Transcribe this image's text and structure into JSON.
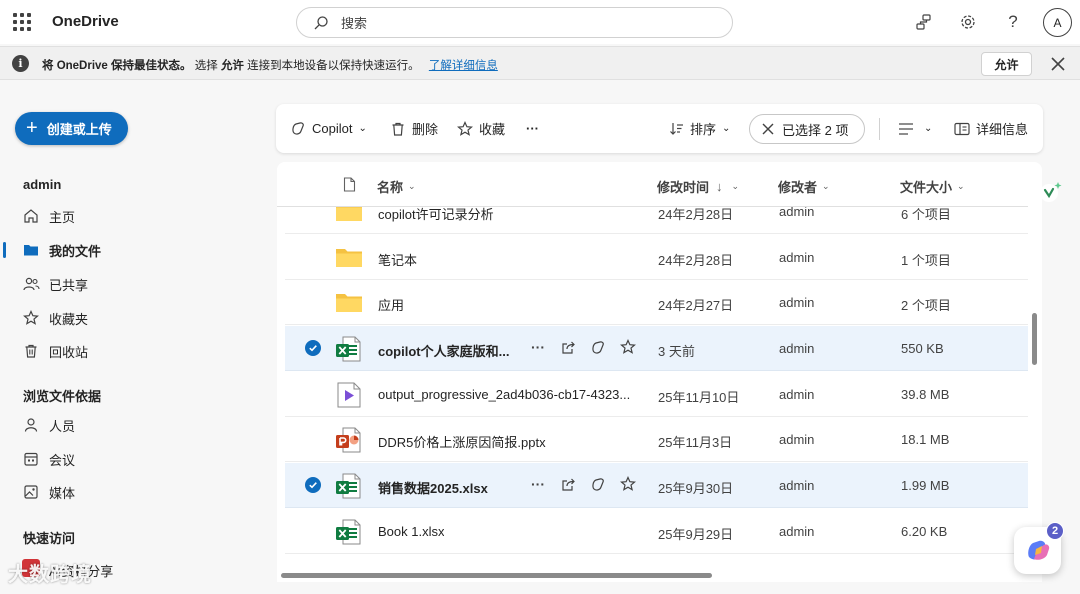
{
  "app": {
    "name": "OneDrive"
  },
  "search": {
    "placeholder": "搜索"
  },
  "top_icons": [
    "network-icon",
    "settings-gear-icon",
    "help-question-icon"
  ],
  "user": {
    "avatar_initial": "A"
  },
  "banner": {
    "prefix": "将 OneDrive 保持最佳状态。",
    "text1": "选择",
    "allow_bold": "允许",
    "text2": "连接到本地设备以保持快速运行。",
    "link": "了解详细信息",
    "allow_button": "允许"
  },
  "sidebar": {
    "create_label": "创建或上传",
    "account": "admin",
    "items": [
      {
        "label": "主页",
        "icon": "home-icon"
      },
      {
        "label": "我的文件",
        "icon": "folder-icon",
        "active": true
      },
      {
        "label": "已共享",
        "icon": "people-icon"
      },
      {
        "label": "收藏夹",
        "icon": "star-icon"
      },
      {
        "label": "回收站",
        "icon": "trash-icon"
      }
    ],
    "browse_heading": "浏览文件依据",
    "browse_items": [
      {
        "label": "人员",
        "icon": "person-icon"
      },
      {
        "label": "会议",
        "icon": "calendar-icon"
      },
      {
        "label": "媒体",
        "icon": "image-icon"
      }
    ],
    "quick_heading": "快速访问",
    "quick_partial": "AI资料分享"
  },
  "commandbar": {
    "copilot": "Copilot",
    "delete": "删除",
    "favorite": "收藏",
    "more": "···",
    "sort": "排序",
    "selected": "已选择 2 项",
    "details": "详细信息"
  },
  "columns": {
    "name": "名称",
    "modified": "修改时间",
    "modified_sort": "↓",
    "modified_by": "修改者",
    "size": "文件大小"
  },
  "files": [
    {
      "name": "copilot许可记录分析",
      "type": "folder",
      "modified": "24年2月28日",
      "by": "admin",
      "size": "6 个项目",
      "selected": false
    },
    {
      "name": "笔记本",
      "type": "folder",
      "modified": "24年2月28日",
      "by": "admin",
      "size": "1 个项目",
      "selected": false
    },
    {
      "name": "应用",
      "type": "folder",
      "modified": "24年2月27日",
      "by": "admin",
      "size": "2 个项目",
      "selected": false
    },
    {
      "name": "copilot个人家庭版和...",
      "type": "excel",
      "modified": "3 天前",
      "by": "admin",
      "size": "550 KB",
      "selected": true
    },
    {
      "name": "output_progressive_2ad4b036-cb17-4323...",
      "type": "video",
      "modified": "25年11月10日",
      "by": "admin",
      "size": "39.8 MB",
      "selected": false
    },
    {
      "name": "DDR5价格上涨原因简报.pptx",
      "type": "ppt",
      "modified": "25年11月3日",
      "by": "admin",
      "size": "18.1 MB",
      "selected": false
    },
    {
      "name": "销售数据2025.xlsx",
      "type": "excel",
      "modified": "25年9月30日",
      "by": "admin",
      "size": "1.99 MB",
      "selected": true
    },
    {
      "name": "Book 1.xlsx",
      "type": "excel",
      "modified": "25年9月29日",
      "by": "admin",
      "size": "6.20 KB",
      "selected": false
    }
  ],
  "copilot_fab": {
    "badge": "2"
  },
  "watermark": "大数跨境",
  "colors": {
    "accent": "#0f6cbd",
    "selected_row": "#ebf3fc",
    "folder": "#f5c242",
    "excel": "#107c41",
    "ppt": "#c43e1c",
    "video": "#7b4fd6"
  }
}
